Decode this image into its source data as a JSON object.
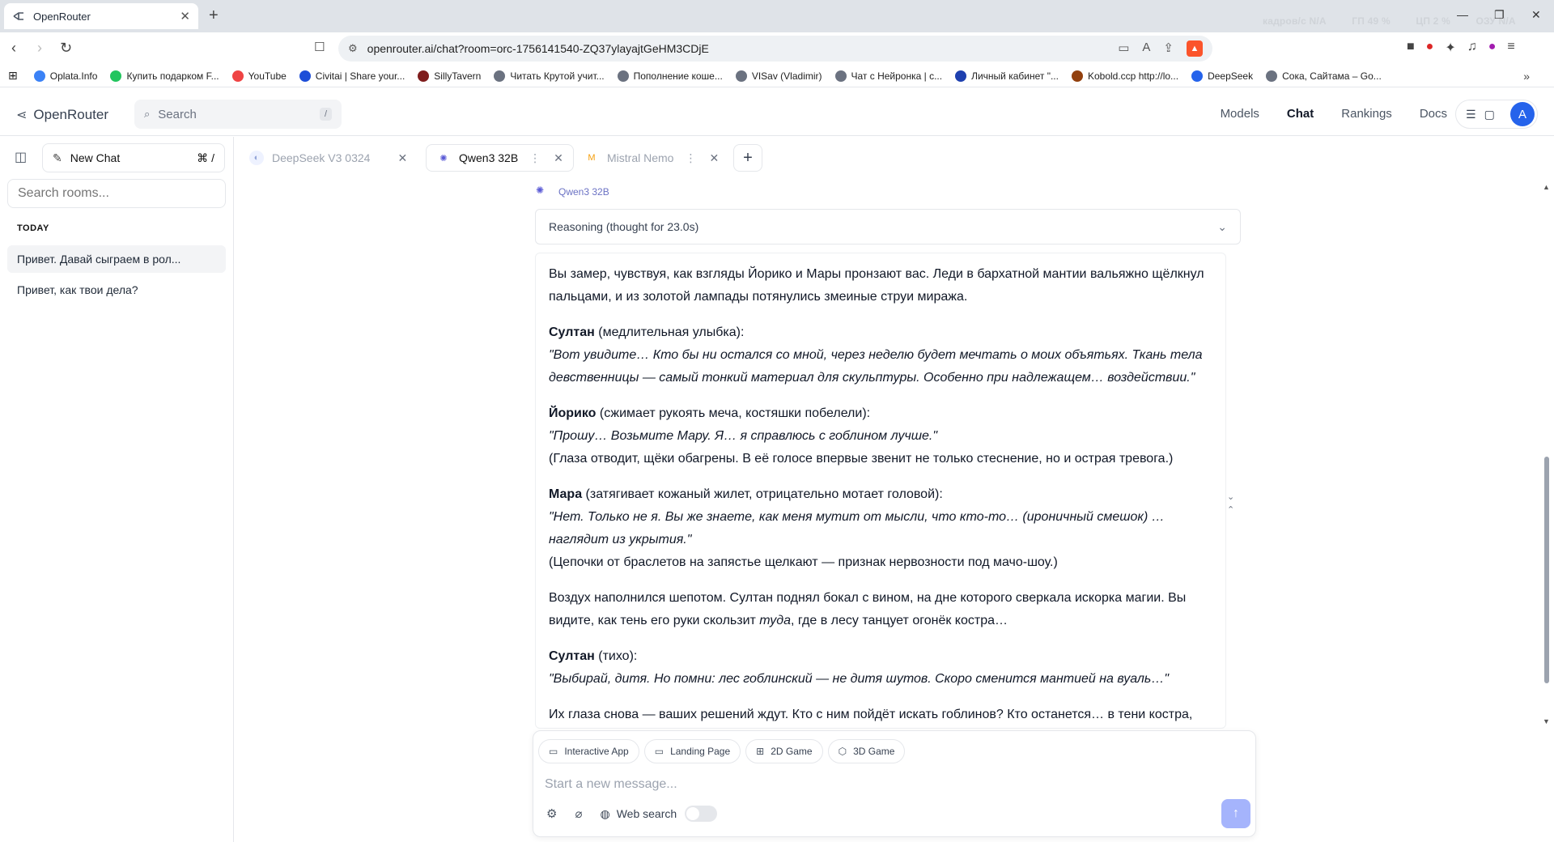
{
  "browser": {
    "tab_title": "OpenRouter",
    "new_tab": "+",
    "url": "openrouter.ai/chat?room=orc-1756141540-ZQ37ylayajtGeHM3CDjE",
    "stats": [
      "кадров/с  N/A",
      "ГП  49 %",
      "ЦП  2 %",
      "ОЗУ  N/A"
    ],
    "window_controls": [
      "—",
      "❐",
      "✕"
    ]
  },
  "bookmarks": [
    {
      "label": "Oplata.Info",
      "color": "#3b82f6"
    },
    {
      "label": "Купить подарком F...",
      "color": "#22c55e"
    },
    {
      "label": "YouTube",
      "color": "#ef4444"
    },
    {
      "label": "Civitai | Share your...",
      "color": "#1d4ed8"
    },
    {
      "label": "SillyTavern",
      "color": "#7f1d1d"
    },
    {
      "label": "Читать Крутой учит...",
      "color": "#6b7280"
    },
    {
      "label": "Пополнение коше...",
      "color": "#6b7280"
    },
    {
      "label": "VISav (Vladimir)",
      "color": "#6b7280"
    },
    {
      "label": "Чат с Нейронка | с...",
      "color": "#6b7280"
    },
    {
      "label": "Личный кабинет \"...",
      "color": "#1e40af"
    },
    {
      "label": "Kobold.ccp http://lo...",
      "color": "#92400e"
    },
    {
      "label": "DeepSeek",
      "color": "#2563eb"
    },
    {
      "label": "Сока, Сайтама – Go...",
      "color": "#6b7280"
    }
  ],
  "header": {
    "logo": "OpenRouter",
    "search_placeholder": "Search",
    "search_kbd": "/",
    "nav": [
      "Models",
      "Chat",
      "Rankings",
      "Docs"
    ],
    "active_nav": "Chat",
    "avatar_initial": "A"
  },
  "sidebar": {
    "new_chat": "New Chat",
    "new_chat_kbd": "⌘  /",
    "search_placeholder": "Search rooms...",
    "section": "TODAY",
    "rooms": [
      "Привет. Давай сыграем в рол...",
      "Привет, как твои дела?"
    ]
  },
  "tabs": [
    {
      "label": "DeepSeek V3 0324",
      "active": false
    },
    {
      "label": "Qwen3 32B",
      "active": true
    },
    {
      "label": "Mistral Nemo",
      "active": false
    }
  ],
  "conversation": {
    "model_label": "Qwen3 32B",
    "reasoning": "Reasoning (thought for 23.0s)",
    "paragraphs": [
      {
        "lines": [
          {
            "n": "Вы замер, чувствуя, как взгляды Йорико и Мары пронзают вас. Леди в бархатной мантии вальяжно щёлкнул пальцами, и из золотой лампады потянулись змеиные струи миража."
          }
        ]
      },
      {
        "lines": [
          {
            "b": "Султан",
            "n": " (медлительная улыбка):"
          },
          {
            "i": "\"Вот увидите… Кто бы ни остался со мной, через неделю будет мечтать о моих объятьях. Ткань тела девственницы — самый тонкий материал для скульптуры. Особенно при надлежащем… воздействии.\""
          }
        ]
      },
      {
        "lines": [
          {
            "b": "Йорико",
            "n": " (сжимает рукоять меча, костяшки побелели):"
          },
          {
            "i": "\"Прошу… Возьмите Мару. Я… я справлюсь с гоблином лучше.\""
          },
          {
            "n": "(Глаза отводит, щёки обагрены. В её голосе впервые звенит не только стеснение, но и острая тревога.)"
          }
        ]
      },
      {
        "lines": [
          {
            "b": "Мара",
            "n": " (затягивает кожаный жилет, отрицательно мотает головой):"
          },
          {
            "i": "\"Нет. Только не я. Вы же знаете, как меня мутит от мысли, что кто-то… (ироничный смешок) …наглядит из укрытия.\""
          },
          {
            "n": "(Цепочки от браслетов на запястье щелкают — признак нервозности под мачо-шоу.)"
          }
        ]
      },
      {
        "lines": [
          {
            "n": "Воздух наполнился шепотом. Султан поднял бокал с вином, на дне которого сверкала искорка магии. Вы видите, как тень его руки скользит ",
            "i": "туда",
            "n2": ", где в лесу танцует огонёк костра…"
          }
        ]
      },
      {
        "lines": [
          {
            "b": "Султан",
            "n": " (тихо):"
          },
          {
            "i": "\"Выбирай, дитя. Но помни: лес гоблинский — не дитя шутов. Скоро сменится мантией на вуаль…\""
          }
        ]
      },
      {
        "lines": [
          {
            "n": "Их глаза снова — ваших решений ждут. Кто с ним пойдёт искать гоблинов? Кто останется… в тени костра,"
          }
        ]
      }
    ]
  },
  "composer": {
    "chips": [
      "Interactive App",
      "Landing Page",
      "2D Game",
      "3D Game"
    ],
    "placeholder": "Start a new message...",
    "web_search": "Web search"
  },
  "colors": {
    "accent": "#6366f1",
    "send_disabled": "#a5b4fc",
    "avatar": "#2563eb"
  }
}
